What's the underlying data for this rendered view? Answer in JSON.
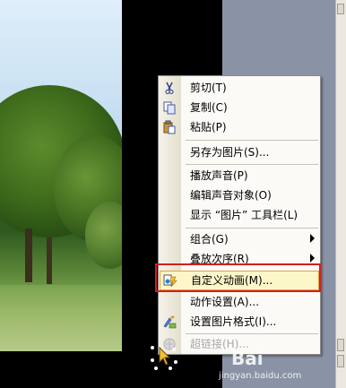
{
  "menu": {
    "items": [
      {
        "label": "剪切(T)",
        "icon": "scissors-icon"
      },
      {
        "label": "复制(C)",
        "icon": "copy-icon"
      },
      {
        "label": "粘贴(P)",
        "icon": "paste-icon"
      },
      {
        "label": "另存为图片(S)...",
        "icon": ""
      },
      {
        "label": "播放声音(P)",
        "icon": ""
      },
      {
        "label": "编辑声音对象(O)",
        "icon": ""
      },
      {
        "label": "显示 “图片” 工具栏(L)",
        "icon": ""
      },
      {
        "label": "组合(G)",
        "icon": "",
        "submenu": true
      },
      {
        "label": "叠放次序(R)",
        "icon": "",
        "submenu": true
      },
      {
        "label": "自定义动画(M)...",
        "icon": "custom-animation-icon",
        "highlighted": true
      },
      {
        "label": "动作设置(A)...",
        "icon": ""
      },
      {
        "label": "设置图片格式(I)...",
        "icon": "format-picture-icon"
      },
      {
        "label": "超链接(H)...",
        "icon": "hyperlink-icon",
        "disabled": true
      }
    ]
  },
  "watermark": {
    "brand": "Bai",
    "url": "jingyan.baidu.com"
  },
  "colors": {
    "highlight_bg": "#fdf6c8",
    "highlight_border": "#e4a23c",
    "annotation_red": "#d41e1e",
    "panel_grey": "#8a93a6"
  }
}
